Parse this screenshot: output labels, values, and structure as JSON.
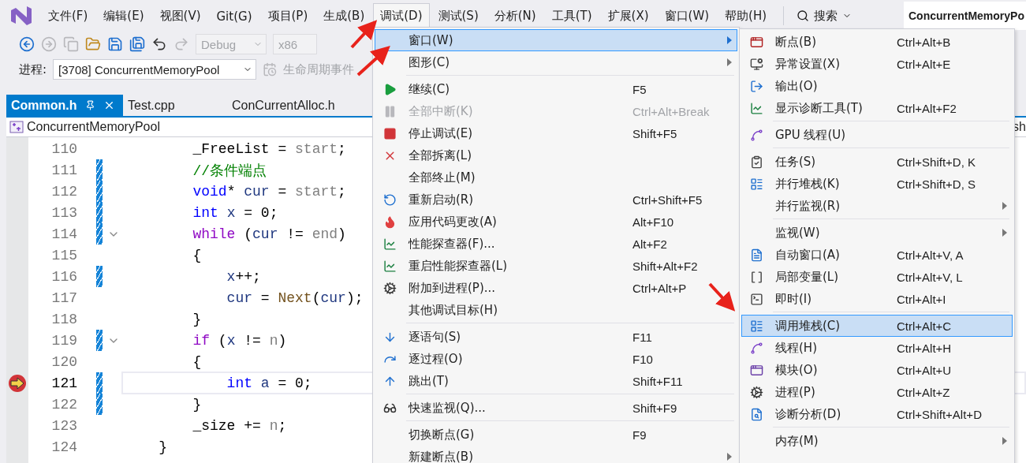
{
  "menu_bar": {
    "items": [
      {
        "label": "文件(F)",
        "selected": false
      },
      {
        "label": "编辑(E)",
        "selected": false
      },
      {
        "label": "视图(V)",
        "selected": false
      },
      {
        "label": "Git(G)",
        "selected": false
      },
      {
        "label": "项目(P)",
        "selected": false
      },
      {
        "label": "生成(B)",
        "selected": false
      },
      {
        "label": "调试(D)",
        "selected": true
      },
      {
        "label": "测试(S)",
        "selected": false
      },
      {
        "label": "分析(N)",
        "selected": false
      },
      {
        "label": "工具(T)",
        "selected": false
      },
      {
        "label": "扩展(X)",
        "selected": false
      },
      {
        "label": "窗口(W)",
        "selected": false
      },
      {
        "label": "帮助(H)",
        "selected": false
      }
    ],
    "search": "搜索",
    "solution_title": "ConcurrentMemoryPo"
  },
  "toolbar": {
    "configuration": "Debug",
    "platform": "x86"
  },
  "debug_bar": {
    "process_label": "进程:",
    "process": "[3708] ConcurrentMemoryPool",
    "lifecycle": "生命周期事件"
  },
  "tabs": [
    {
      "label": "Common.h",
      "selected": true
    },
    {
      "label": "Test.cpp",
      "selected": false
    },
    {
      "label": "ConCurrentAlloc.h",
      "selected": false
    }
  ],
  "nav_bar": {
    "scope": "ConcurrentMemoryPool",
    "right_text": "sh"
  },
  "editor": {
    "lines": [
      {
        "number": "110",
        "changed": false,
        "fold": false,
        "current": false,
        "tokens": [
          {
            "t": "        _FreeList = ",
            "kind": "plain"
          },
          {
            "t": "start",
            "kind": "param"
          },
          {
            "t": ";",
            "kind": "plain"
          }
        ]
      },
      {
        "number": "111",
        "changed": true,
        "fold": false,
        "current": false,
        "tokens": [
          {
            "t": "        //条件端点",
            "kind": "comment"
          }
        ]
      },
      {
        "number": "112",
        "changed": true,
        "fold": false,
        "current": false,
        "tokens": [
          {
            "t": "        void",
            "kind": "keyword"
          },
          {
            "t": "* ",
            "kind": "plain"
          },
          {
            "t": "cur",
            "kind": "local"
          },
          {
            "t": " = ",
            "kind": "plain"
          },
          {
            "t": "start",
            "kind": "param"
          },
          {
            "t": ";",
            "kind": "plain"
          }
        ]
      },
      {
        "number": "113",
        "changed": true,
        "fold": false,
        "current": false,
        "tokens": [
          {
            "t": "        int",
            "kind": "keyword"
          },
          {
            "t": " x",
            "kind": "local"
          },
          {
            "t": " = 0;",
            "kind": "plain"
          }
        ]
      },
      {
        "number": "114",
        "changed": true,
        "fold": true,
        "current": false,
        "tokens": [
          {
            "t": "        while",
            "kind": "control"
          },
          {
            "t": " (",
            "kind": "plain"
          },
          {
            "t": "cur",
            "kind": "local"
          },
          {
            "t": " != ",
            "kind": "plain"
          },
          {
            "t": "end",
            "kind": "param"
          },
          {
            "t": ")",
            "kind": "plain"
          }
        ]
      },
      {
        "number": "115",
        "changed": false,
        "fold": false,
        "current": false,
        "tokens": [
          {
            "t": "        {",
            "kind": "plain"
          }
        ]
      },
      {
        "number": "116",
        "changed": true,
        "fold": false,
        "current": false,
        "tokens": [
          {
            "t": "            x",
            "kind": "local"
          },
          {
            "t": "++;",
            "kind": "plain"
          }
        ]
      },
      {
        "number": "117",
        "changed": false,
        "fold": false,
        "current": false,
        "tokens": [
          {
            "t": "            cur",
            "kind": "local"
          },
          {
            "t": " = ",
            "kind": "plain"
          },
          {
            "t": "Next",
            "kind": "function"
          },
          {
            "t": "(",
            "kind": "plain"
          },
          {
            "t": "cur",
            "kind": "local"
          },
          {
            "t": ");",
            "kind": "plain"
          }
        ]
      },
      {
        "number": "118",
        "changed": false,
        "fold": false,
        "current": false,
        "tokens": [
          {
            "t": "        }",
            "kind": "plain"
          }
        ]
      },
      {
        "number": "119",
        "changed": true,
        "fold": true,
        "current": false,
        "tokens": [
          {
            "t": "        if",
            "kind": "control"
          },
          {
            "t": " (",
            "kind": "plain"
          },
          {
            "t": "x",
            "kind": "local"
          },
          {
            "t": " != ",
            "kind": "plain"
          },
          {
            "t": "n",
            "kind": "param"
          },
          {
            "t": ")",
            "kind": "plain"
          }
        ]
      },
      {
        "number": "120",
        "changed": false,
        "fold": false,
        "current": false,
        "tokens": [
          {
            "t": "        {",
            "kind": "plain"
          }
        ]
      },
      {
        "number": "121",
        "changed": true,
        "fold": false,
        "current": true,
        "tokens": [
          {
            "t": "            int",
            "kind": "keyword"
          },
          {
            "t": " a",
            "kind": "local"
          },
          {
            "t": " = 0;",
            "kind": "plain"
          }
        ]
      },
      {
        "number": "122",
        "changed": true,
        "fold": false,
        "current": false,
        "tokens": [
          {
            "t": "        }",
            "kind": "plain"
          }
        ]
      },
      {
        "number": "123",
        "changed": false,
        "fold": false,
        "current": false,
        "tokens": [
          {
            "t": "        _size += ",
            "kind": "plain"
          },
          {
            "t": "n",
            "kind": "param"
          },
          {
            "t": ";",
            "kind": "plain"
          }
        ]
      },
      {
        "number": "124",
        "changed": false,
        "fold": false,
        "current": false,
        "tokens": [
          {
            "t": "    }",
            "kind": "plain"
          }
        ]
      }
    ]
  },
  "debug_menu": {
    "items": [
      {
        "kind": "item",
        "label": "窗口(W)",
        "selected": true,
        "disabled": false,
        "submenu": true
      },
      {
        "kind": "item",
        "label": "图形(C)",
        "selected": false,
        "disabled": false,
        "submenu": true
      },
      {
        "kind": "separator"
      },
      {
        "kind": "item",
        "label": "继续(C)",
        "shortcut": "F5",
        "selected": false,
        "disabled": false,
        "submenu": false
      },
      {
        "kind": "item",
        "label": "全部中断(K)",
        "shortcut": "Ctrl+Alt+Break",
        "selected": false,
        "disabled": true,
        "submenu": false
      },
      {
        "kind": "item",
        "label": "停止调试(E)",
        "shortcut": "Shift+F5",
        "selected": false,
        "disabled": false,
        "submenu": false
      },
      {
        "kind": "item",
        "label": "全部拆离(L)",
        "selected": false,
        "disabled": false,
        "submenu": false
      },
      {
        "kind": "item",
        "label": "全部终止(M)",
        "selected": false,
        "disabled": false,
        "submenu": false
      },
      {
        "kind": "item",
        "label": "重新启动(R)",
        "shortcut": "Ctrl+Shift+F5",
        "selected": false,
        "disabled": false,
        "submenu": false
      },
      {
        "kind": "item",
        "label": "应用代码更改(A)",
        "shortcut": "Alt+F10",
        "selected": false,
        "disabled": false,
        "submenu": false
      },
      {
        "kind": "item",
        "label": "性能探查器(F)...",
        "shortcut": "Alt+F2",
        "selected": false,
        "disabled": false,
        "submenu": false
      },
      {
        "kind": "item",
        "label": "重启性能探查器(L)",
        "shortcut": "Shift+Alt+F2",
        "selected": false,
        "disabled": false,
        "submenu": false
      },
      {
        "kind": "item",
        "label": "附加到进程(P)...",
        "shortcut": "Ctrl+Alt+P",
        "selected": false,
        "disabled": false,
        "submenu": false
      },
      {
        "kind": "item",
        "label": "其他调试目标(H)",
        "selected": false,
        "disabled": false,
        "submenu": false
      },
      {
        "kind": "separator"
      },
      {
        "kind": "item",
        "label": "逐语句(S)",
        "shortcut": "F11",
        "selected": false,
        "disabled": false,
        "submenu": false
      },
      {
        "kind": "item",
        "label": "逐过程(O)",
        "shortcut": "F10",
        "selected": false,
        "disabled": false,
        "submenu": false
      },
      {
        "kind": "item",
        "label": "跳出(T)",
        "shortcut": "Shift+F11",
        "selected": false,
        "disabled": false,
        "submenu": false
      },
      {
        "kind": "separator"
      },
      {
        "kind": "item",
        "label": "快速监视(Q)...",
        "shortcut": "Shift+F9",
        "selected": false,
        "disabled": false,
        "submenu": false
      },
      {
        "kind": "separator"
      },
      {
        "kind": "item",
        "label": "切换断点(G)",
        "shortcut": "F9",
        "selected": false,
        "disabled": false,
        "submenu": false
      },
      {
        "kind": "item",
        "label": "新建断点(B)",
        "selected": false,
        "disabled": false,
        "submenu": true
      }
    ]
  },
  "window_submenu": {
    "items": [
      {
        "kind": "item",
        "label": "断点(B)",
        "shortcut": "Ctrl+Alt+B",
        "selected": false,
        "submenu": false
      },
      {
        "kind": "item",
        "label": "异常设置(X)",
        "shortcut": "Ctrl+Alt+E",
        "selected": false,
        "submenu": false
      },
      {
        "kind": "item",
        "label": "输出(O)",
        "selected": false,
        "submenu": false
      },
      {
        "kind": "item",
        "label": "显示诊断工具(T)",
        "shortcut": "Ctrl+Alt+F2",
        "selected": false,
        "submenu": false
      },
      {
        "kind": "separator"
      },
      {
        "kind": "item",
        "label": "GPU 线程(U)",
        "selected": false,
        "submenu": false
      },
      {
        "kind": "separator"
      },
      {
        "kind": "item",
        "label": "任务(S)",
        "shortcut": "Ctrl+Shift+D, K",
        "selected": false,
        "submenu": false
      },
      {
        "kind": "item",
        "label": "并行堆栈(K)",
        "shortcut": "Ctrl+Shift+D, S",
        "selected": false,
        "submenu": false
      },
      {
        "kind": "item",
        "label": "并行监视(R)",
        "selected": false,
        "submenu": true
      },
      {
        "kind": "separator"
      },
      {
        "kind": "item",
        "label": "监视(W)",
        "selected": false,
        "submenu": true
      },
      {
        "kind": "item",
        "label": "自动窗口(A)",
        "shortcut": "Ctrl+Alt+V, A",
        "selected": false,
        "submenu": false
      },
      {
        "kind": "item",
        "label": "局部变量(L)",
        "shortcut": "Ctrl+Alt+V, L",
        "selected": false,
        "submenu": false
      },
      {
        "kind": "item",
        "label": "即时(I)",
        "shortcut": "Ctrl+Alt+I",
        "selected": false,
        "submenu": false
      },
      {
        "kind": "separator"
      },
      {
        "kind": "item",
        "label": "调用堆栈(C)",
        "shortcut": "Ctrl+Alt+C",
        "selected": true,
        "submenu": false
      },
      {
        "kind": "item",
        "label": "线程(H)",
        "shortcut": "Ctrl+Alt+H",
        "selected": false,
        "submenu": false
      },
      {
        "kind": "item",
        "label": "模块(O)",
        "shortcut": "Ctrl+Alt+U",
        "selected": false,
        "submenu": false
      },
      {
        "kind": "item",
        "label": "进程(P)",
        "shortcut": "Ctrl+Alt+Z",
        "selected": false,
        "submenu": false
      },
      {
        "kind": "item",
        "label": "诊断分析(D)",
        "shortcut": "Ctrl+Shift+Alt+D",
        "selected": false,
        "submenu": false
      },
      {
        "kind": "separator"
      },
      {
        "kind": "item",
        "label": "内存(M)",
        "selected": false,
        "submenu": true
      }
    ]
  }
}
